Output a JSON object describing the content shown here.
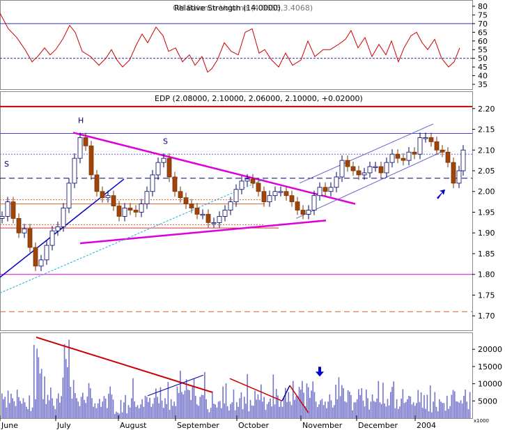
{
  "chart_data": [
    {
      "panel": "indicator",
      "type": "line",
      "title": "Relative Strength (14.0000)",
      "title_overlay": "ON Balance Volume (4.0655,3.4068)",
      "y_ticks": [
        35,
        40,
        45,
        50,
        55,
        60,
        65,
        70,
        75,
        80
      ],
      "ylim": [
        33,
        82
      ],
      "reference_lines": [
        {
          "value": 70,
          "style": "solid"
        },
        {
          "value": 50,
          "style": "dashed"
        }
      ],
      "series": [
        {
          "type": "line",
          "color": "#cc0000",
          "x": [
            0,
            12,
            24,
            36,
            46,
            54,
            64,
            72,
            80,
            90,
            100,
            108,
            118,
            130,
            142,
            152,
            160,
            168,
            176,
            186,
            196,
            204,
            212,
            224,
            234,
            242,
            252,
            262,
            272,
            280,
            290,
            298,
            304,
            312,
            322,
            332,
            342,
            352,
            362,
            372,
            380,
            390,
            400,
            410,
            420,
            432,
            442,
            452,
            464,
            474,
            486,
            496,
            504,
            514,
            524,
            534,
            544,
            554,
            562,
            572,
            580,
            590,
            598,
            606,
            614,
            624,
            634,
            644,
            652,
            660
          ],
          "values": [
            76,
            67,
            62,
            55,
            48,
            51,
            56,
            52,
            55,
            61,
            69,
            65,
            54,
            51,
            46,
            50,
            55,
            49,
            45,
            49,
            58,
            64,
            59,
            68,
            63,
            54,
            56,
            48,
            52,
            46,
            51,
            42,
            44,
            49,
            59,
            54,
            52,
            65,
            67,
            53,
            55,
            49,
            45,
            53,
            46,
            49,
            60,
            51,
            55,
            55,
            58,
            61,
            66,
            56,
            62,
            51,
            58,
            52,
            60,
            48,
            56,
            63,
            65,
            59,
            55,
            61,
            50,
            45,
            48,
            56
          ]
        }
      ]
    },
    {
      "panel": "price",
      "type": "line",
      "title": "EDP (2.08000, 2.10000, 2.06000, 2.10000, +0.02000)",
      "y_ticks": [
        1.7,
        1.75,
        1.8,
        1.85,
        1.9,
        1.95,
        2.0,
        2.05,
        2.1,
        2.15,
        2.2
      ],
      "ylim": [
        1.665,
        2.24
      ],
      "annotations": [
        {
          "text": "S",
          "x": 6,
          "y": 2.06
        },
        {
          "text": "H",
          "x": 112,
          "y": 2.165
        },
        {
          "text": "S",
          "x": 234,
          "y": 2.115
        }
      ],
      "horizontal_lines": [
        {
          "value": 2.205,
          "color": "#cc0000",
          "style": "solid"
        },
        {
          "value": 2.14,
          "color": "#4444dd",
          "style": "solid"
        },
        {
          "value": 2.09,
          "color": "#6666ee",
          "style": "dotted"
        },
        {
          "value": 2.032,
          "color": "#000080",
          "style": "dashed"
        },
        {
          "value": 1.98,
          "color": "#cc6633",
          "style": "dotted",
          "x_end": 380
        },
        {
          "value": 1.97,
          "color": "#cc6633",
          "style": "solid",
          "x_end": 380
        },
        {
          "value": 1.92,
          "color": "#cc6633",
          "style": "dotted",
          "x_end": 380
        },
        {
          "value": 1.912,
          "color": "#cc3333",
          "style": "solid",
          "x_end": 400
        },
        {
          "value": 1.8,
          "color": "#dd00dd",
          "style": "solid"
        },
        {
          "value": 1.71,
          "color": "#cc6633",
          "style": "dashed"
        }
      ],
      "trend_lines": [
        {
          "points": [
            [
              105,
              2.142
            ],
            [
              510,
              1.97
            ]
          ],
          "color": "#dd00dd",
          "width": 2.5
        },
        {
          "points": [
            [
              115,
              1.875
            ],
            [
              468,
              1.93
            ]
          ],
          "color": "#dd00dd",
          "width": 2.5
        },
        {
          "points": [
            [
              0,
              1.793
            ],
            [
              178,
              2.03
            ]
          ],
          "color": "#0000cc",
          "width": 1.5
        },
        {
          "points": [
            [
              0,
              1.755
            ],
            [
              380,
              2.03
            ]
          ],
          "color": "#22aadd",
          "width": 1,
          "style": "dashed"
        },
        {
          "points": [
            [
              425,
              1.935
            ],
            [
              640,
              2.1
            ]
          ],
          "color": "#6666cc",
          "width": 1
        },
        {
          "points": [
            [
              430,
              2.02
            ],
            [
              622,
              2.163
            ]
          ],
          "color": "#6666cc",
          "width": 1
        }
      ],
      "series": [
        {
          "type": "candlestick",
          "x": [
            0,
            8,
            16,
            24,
            32,
            40,
            48,
            56,
            64,
            72,
            80,
            88,
            96,
            104,
            112,
            120,
            128,
            136,
            144,
            152,
            160,
            168,
            176,
            184,
            192,
            200,
            208,
            216,
            224,
            232,
            240,
            248,
            256,
            264,
            272,
            280,
            288,
            296,
            304,
            312,
            320,
            328,
            336,
            344,
            352,
            360,
            368,
            376,
            384,
            392,
            400,
            408,
            416,
            424,
            432,
            440,
            448,
            456,
            464,
            472,
            480,
            488,
            496,
            504,
            512,
            520,
            528,
            536,
            544,
            552,
            560,
            568,
            576,
            584,
            592,
            600,
            608,
            616,
            624,
            632,
            640,
            648,
            656,
            662
          ],
          "values": [
            1.94,
            1.975,
            1.935,
            1.9,
            1.91,
            1.865,
            1.82,
            1.835,
            1.87,
            1.905,
            1.915,
            1.96,
            2.02,
            2.08,
            2.13,
            2.11,
            2.04,
            2.0,
            1.985,
            1.99,
            1.965,
            1.94,
            1.96,
            1.955,
            1.95,
            1.97,
            2.0,
            2.04,
            2.07,
            2.08,
            2.035,
            2.0,
            1.985,
            1.97,
            1.96,
            1.945,
            1.945,
            1.925,
            1.925,
            1.94,
            1.955,
            1.975,
            2.005,
            2.025,
            2.03,
            2.02,
            2.0,
            1.975,
            1.99,
            2.0,
            2.0,
            1.99,
            1.975,
            1.955,
            1.945,
            1.955,
            1.99,
            2.01,
            2.0,
            2.01,
            2.035,
            2.075,
            2.06,
            2.05,
            2.04,
            2.045,
            2.06,
            2.06,
            2.045,
            2.07,
            2.09,
            2.08,
            2.075,
            2.095,
            2.09,
            2.13,
            2.13,
            2.12,
            2.1,
            2.095,
            2.07,
            2.02,
            2.05,
            2.1
          ]
        }
      ]
    },
    {
      "panel": "volume",
      "type": "bar",
      "y_ticks": [
        5000,
        10000,
        15000,
        20000
      ],
      "ylim": [
        0,
        24500
      ],
      "y_ticks_extra": "x1000",
      "x_labels": [
        {
          "label": "June",
          "x": 0
        },
        {
          "label": "July",
          "x": 80
        },
        {
          "label": "August",
          "x": 170
        },
        {
          "label": "September",
          "x": 252
        },
        {
          "label": "October",
          "x": 340
        },
        {
          "label": "November",
          "x": 432
        },
        {
          "label": "December",
          "x": 512
        },
        {
          "label": "2004",
          "x": 596
        }
      ],
      "arrow_annotations": [
        {
          "panel": "volume",
          "x": 459,
          "y": 12500,
          "direction": "down",
          "color": "#0000cc"
        },
        {
          "panel": "price",
          "x": 633,
          "y": 1.995,
          "direction": "up-right",
          "color": "#0000cc"
        }
      ],
      "trend_lines": [
        {
          "points": [
            [
              52,
              23500
            ],
            [
              305,
              7500
            ]
          ],
          "color": "#cc0000",
          "width": 2
        },
        {
          "points": [
            [
              212,
              6500
            ],
            [
              292,
              12500
            ]
          ],
          "color": "#0000aa",
          "width": 1
        },
        {
          "points": [
            [
              330,
              11500
            ],
            [
              405,
              5000
            ]
          ],
          "color": "#cc0000",
          "width": 1.5
        },
        {
          "points": [
            [
              405,
              5000
            ],
            [
              416,
              9500
            ]
          ],
          "color": "#0000aa",
          "width": 1.5
        },
        {
          "points": [
            [
              416,
              9500
            ],
            [
              443,
              1500
            ]
          ],
          "color": "#cc0000",
          "width": 1.5
        }
      ],
      "series": [
        {
          "type": "bar",
          "color": "#7777cc",
          "values": [
            7200,
            5500,
            6200,
            3100,
            8000,
            4400,
            7100,
            5800,
            4900,
            3500,
            8300,
            6100,
            5000,
            4200,
            5800,
            4600,
            3300,
            2600,
            6600,
            2100,
            3100,
            21300,
            5500,
            20200,
            17700,
            13000,
            14300,
            5500,
            12100,
            4100,
            6800,
            5200,
            8900,
            5800,
            3600,
            2600,
            5700,
            7200,
            4500,
            6400,
            11800,
            21500,
            17200,
            14800,
            22800,
            9100,
            5700,
            11100,
            7300,
            5800,
            4800,
            3500,
            6200,
            7400,
            5300,
            4400,
            6300,
            10200,
            8700,
            5800,
            3300,
            4300,
            2900,
            4300,
            5600,
            3300,
            4800,
            6400,
            5700,
            2900,
            7100,
            9200,
            6900,
            5400,
            1200,
            1900,
            1600,
            1300,
            5300,
            1700,
            4600,
            6700,
            1400,
            3800,
            3100,
            5800,
            11600,
            4900,
            3300,
            3800,
            2900,
            4000,
            5500,
            3300,
            6500,
            6200,
            4700,
            5900,
            3300,
            4200,
            5900,
            8600,
            6200,
            4300,
            9000,
            5100,
            3000,
            5800,
            4100,
            10500,
            2400,
            5500,
            3600,
            4800,
            3500,
            9200,
            7300,
            13800,
            7600,
            6900,
            8000,
            11300,
            8300,
            8100,
            5300,
            9100,
            11400,
            6500,
            4000,
            3600,
            6200,
            6800,
            6700,
            13400,
            5500,
            2600,
            1700,
            3000,
            7800,
            4200,
            4000,
            3100,
            4800,
            5000,
            2900,
            9200,
            4300,
            10100,
            3500,
            2200,
            4100,
            4600,
            8300,
            2300,
            4600,
            3300,
            5800,
            7500,
            2600,
            6200,
            4200,
            12800,
            2000,
            5300,
            3700,
            3600,
            8000,
            5400,
            6900,
            5300,
            9800,
            4800,
            6200,
            2400,
            4100,
            4700,
            5700,
            3400,
            12700,
            4000,
            8500,
            6600,
            3300,
            4900,
            3300,
            6100,
            8800,
            4700,
            7600,
            4800,
            3800,
            10800,
            5300,
            6400,
            6400,
            9100,
            8300,
            10800,
            7400,
            3500,
            10100,
            9000,
            5900,
            8000,
            10700,
            7600,
            4800,
            3200,
            4000,
            5200,
            5600,
            3800,
            4800,
            2900,
            4800,
            6900,
            5200,
            3100,
            3800,
            9700,
            5500,
            11900,
            6400,
            9600,
            8700,
            4900,
            4600,
            8100,
            7700,
            6700,
            2300,
            4600,
            4600,
            5500,
            8400,
            6700,
            8700,
            5100,
            3400,
            8300,
            5800,
            2500,
            4800,
            6900,
            5000,
            4700,
            5700,
            10800,
            4600,
            4100,
            10300,
            4300,
            3400,
            5600,
            3700,
            7600,
            9100,
            10700,
            2900,
            5500,
            2700,
            3400,
            5700,
            8400,
            4400,
            4700,
            5500,
            6500,
            6300,
            4000,
            4600,
            3600,
            4400,
            8200,
            4700,
            7500,
            3000,
            6700,
            2700,
            6800,
            2000,
            9500,
            1700,
            4800,
            7600,
            3300,
            2000,
            5500,
            4800,
            4400,
            4400,
            2200,
            6500,
            2700,
            3500,
            6800,
            8200,
            7800,
            4900,
            4800,
            4500,
            5200,
            4300,
            6500,
            8300,
            4800,
            2600,
            7600
          ]
        }
      ]
    }
  ]
}
